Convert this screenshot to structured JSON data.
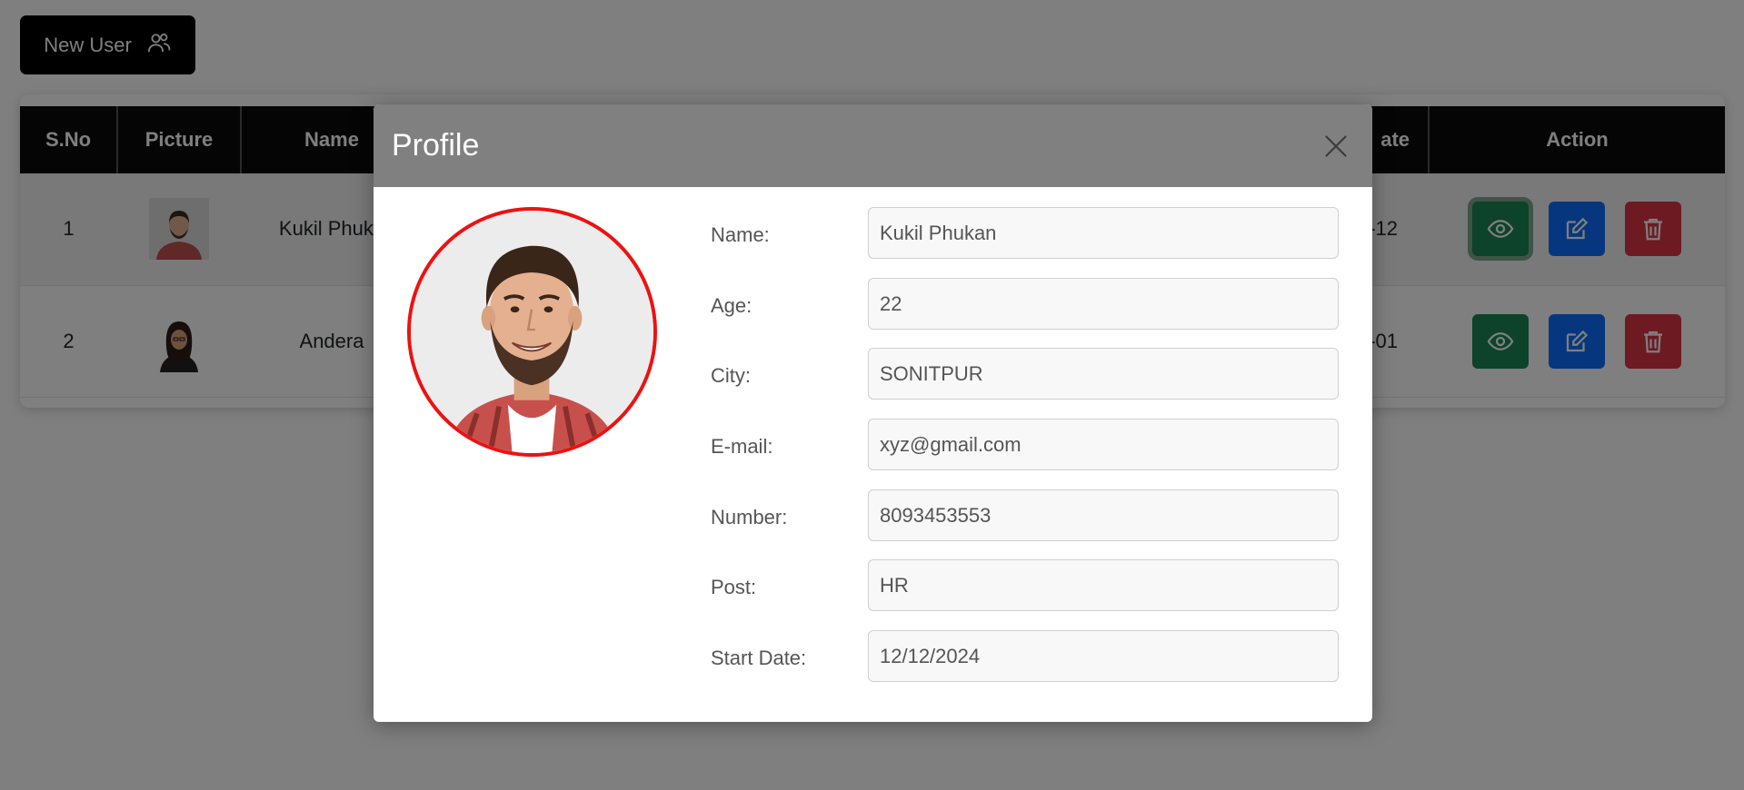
{
  "toolbar": {
    "new_user_label": "New User",
    "icon": "users-icon"
  },
  "table": {
    "headers": [
      "S.No",
      "Picture",
      "Name",
      "ate",
      "Action"
    ],
    "rows": [
      {
        "sno": "1",
        "name": "Kukil Phuka",
        "date": "-12"
      },
      {
        "sno": "2",
        "name": "Andera",
        "date": "-01"
      }
    ]
  },
  "colors": {
    "view": "#198754",
    "edit": "#0d6efd",
    "delete": "#dc3545",
    "header_bg": "#0b0b0b",
    "modal_header_bg": "#808080",
    "avatar_border": "#ee1111"
  },
  "modal": {
    "title": "Profile",
    "close_icon": "close-icon",
    "fields": [
      {
        "label": "Name:",
        "value": "Kukil Phukan"
      },
      {
        "label": "Age:",
        "value": "22"
      },
      {
        "label": "City:",
        "value": "SONITPUR"
      },
      {
        "label": "E-mail:",
        "value": "xyz@gmail.com"
      },
      {
        "label": "Number:",
        "value": "8093453553"
      },
      {
        "label": "Post:",
        "value": "HR"
      },
      {
        "label": "Start Date:",
        "value": "12/12/2024"
      }
    ]
  }
}
